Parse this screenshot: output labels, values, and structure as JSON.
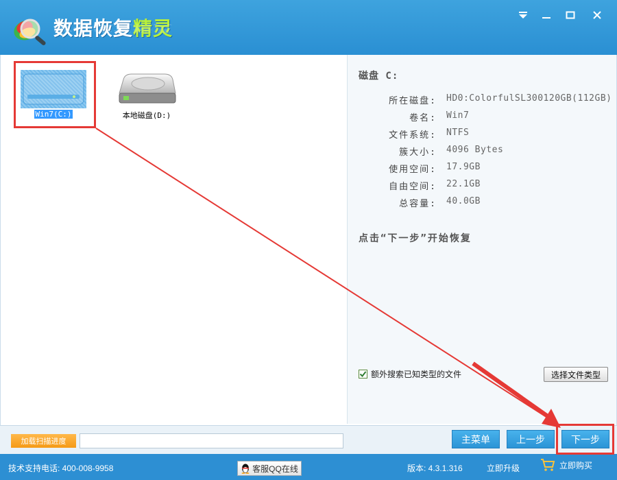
{
  "window": {
    "title_main": "数据恢复",
    "title_accent": "精灵"
  },
  "drives": [
    {
      "label": "Win7(C:)",
      "selected": true,
      "icon": "hard-drive-icon"
    },
    {
      "label": "本地磁盘(D:)",
      "selected": false,
      "icon": "hard-drive-icon"
    }
  ],
  "disk_info": {
    "heading": "磁盘 C:",
    "rows": [
      {
        "label": "所在磁盘:",
        "value": "HD0:ColorfulSL300120GB(112GB)"
      },
      {
        "label": "卷名:",
        "value": "Win7"
      },
      {
        "label": "文件系统:",
        "value": "NTFS"
      },
      {
        "label": "簇大小:",
        "value": "4096 Bytes"
      },
      {
        "label": "使用空间:",
        "value": "17.9GB"
      },
      {
        "label": "自由空间:",
        "value": "22.1GB"
      },
      {
        "label": "总容量:",
        "value": "40.0GB"
      }
    ],
    "hint": "点击“下一步”开始恢复"
  },
  "options": {
    "extra_search_label": "额外搜索已知类型的文件",
    "extra_search_checked": true,
    "file_type_button": "选择文件类型"
  },
  "bottom": {
    "load_progress_button": "加载扫描进度",
    "main_menu_button": "主菜单",
    "prev_button": "上一步",
    "next_button": "下一步"
  },
  "status": {
    "support": "技术支持电话: 400-008-9958",
    "qq_service": "客服QQ在线",
    "version": "版本: 4.3.1.316",
    "upgrade": "立即升级",
    "buy": "立即购买"
  },
  "colors": {
    "accent_blue": "#2d8fd3",
    "title_accent": "#b8f03a",
    "annotation_red": "#e53935",
    "load_button": "#f59a16"
  }
}
